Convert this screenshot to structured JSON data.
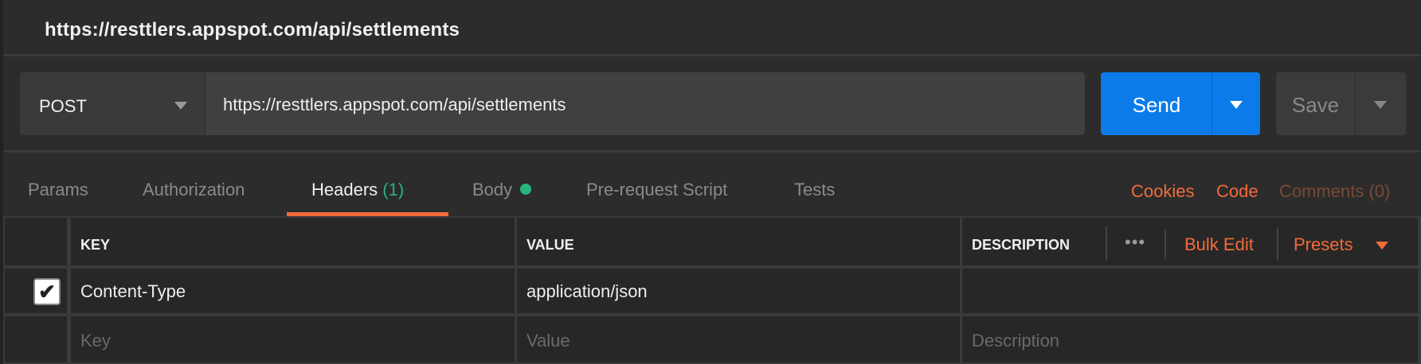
{
  "header": {
    "title": "https://resttlers.appspot.com/api/settlements"
  },
  "request": {
    "method": "POST",
    "url": "https://resttlers.appspot.com/api/settlements",
    "send_label": "Send",
    "save_label": "Save"
  },
  "tabs": [
    {
      "label": "Params"
    },
    {
      "label": "Authorization"
    },
    {
      "label": "Headers",
      "count": "(1)"
    },
    {
      "label": "Body"
    },
    {
      "label": "Pre-request Script"
    },
    {
      "label": "Tests"
    }
  ],
  "links": {
    "cookies": "Cookies",
    "code": "Code",
    "comments": "Comments (0)"
  },
  "table": {
    "columns": {
      "key": "KEY",
      "value": "VALUE",
      "description": "DESCRIPTION"
    },
    "more": "•••",
    "bulk_edit": "Bulk Edit",
    "presets": "Presets",
    "rows": [
      {
        "checked": true,
        "check": "✔",
        "key": "Content-Type",
        "value": "application/json",
        "description": ""
      }
    ],
    "placeholders": {
      "key": "Key",
      "value": "Value",
      "description": "Description"
    }
  },
  "colors": {
    "accent": "#f26b3a",
    "send": "#0c7bea",
    "success": "#26b47f"
  }
}
